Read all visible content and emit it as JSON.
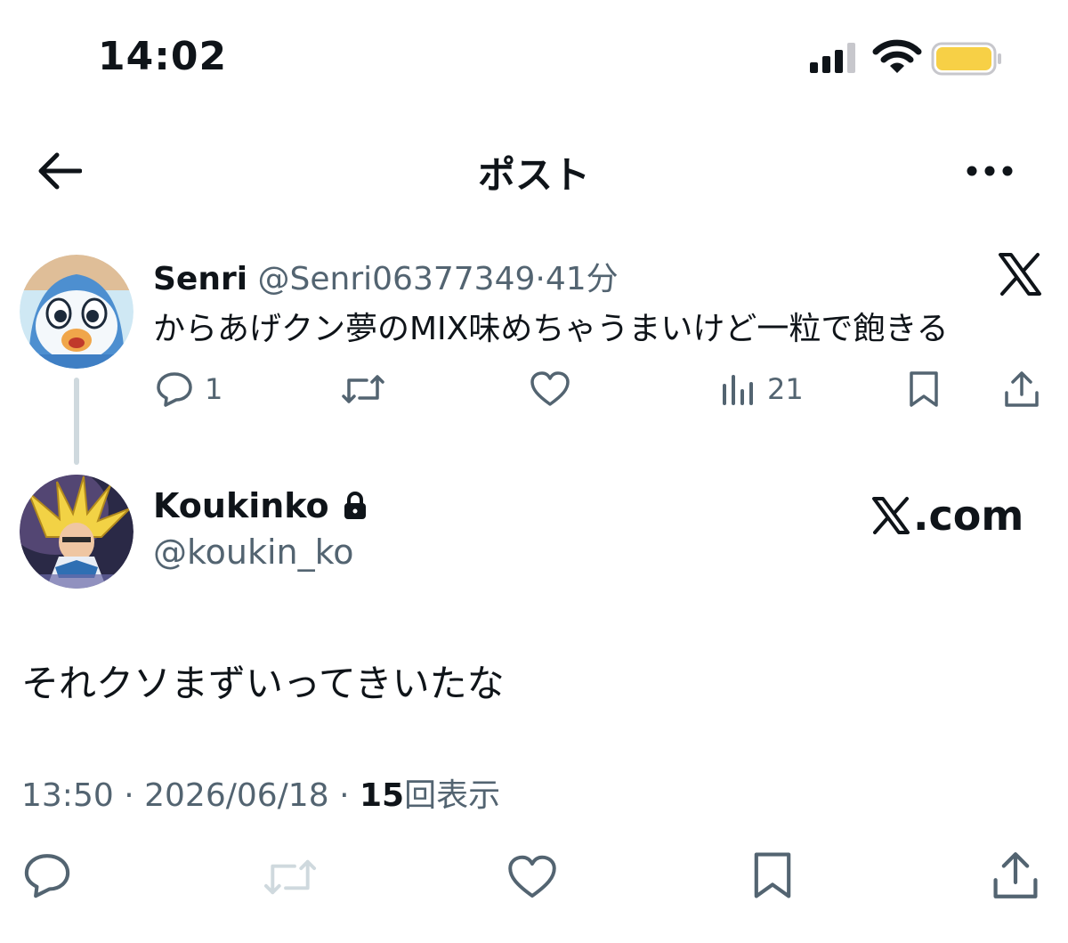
{
  "status_bar": {
    "time": "14:02"
  },
  "nav": {
    "title": "ポスト"
  },
  "quoted_post": {
    "display_name": "Senri",
    "handle": "@Senri06377349",
    "separator": "·",
    "age": "41分",
    "text": "からあげクン夢のMIX味めちゃうまいけど一粒で飽きる",
    "reply_count": "1",
    "view_count": "21"
  },
  "main_post": {
    "display_name": "Koukinko",
    "handle": "@koukin_ko",
    "watermark": "com",
    "text": "それクソまずいってきいたな",
    "time": "13:50",
    "date": "2026/06/18",
    "separator": "·",
    "views_number": "15",
    "views_label": "回表示"
  },
  "colors": {
    "text": "#0f1419",
    "secondary": "#536471",
    "thread_line": "#cfd9de",
    "battery": "#f7d046"
  },
  "icons": [
    "back-arrow-icon",
    "more-icon",
    "x-logo-icon",
    "reply-icon",
    "repost-icon",
    "like-icon",
    "views-icon",
    "bookmark-icon",
    "share-icon",
    "lock-icon"
  ]
}
